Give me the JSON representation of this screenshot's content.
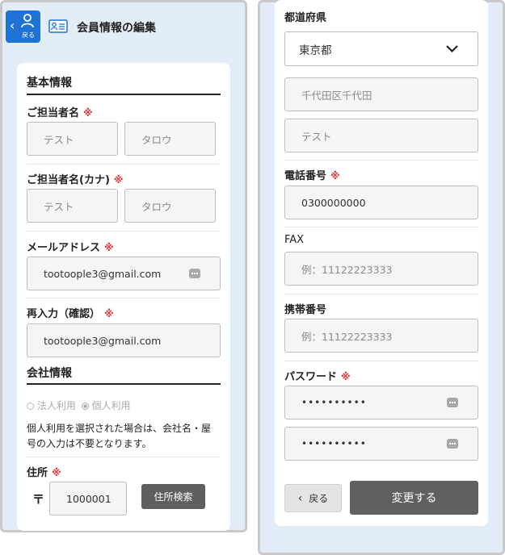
{
  "header": {
    "back_label": "戻る",
    "title": "会員情報の編集"
  },
  "basic": {
    "section_title": "基本情報",
    "contact_name_label": "ご担当者名",
    "contact_name_last": "テスト",
    "contact_name_first": "タロウ",
    "kana_label": "ご担当者名(カナ)",
    "kana_last": "テスト",
    "kana_first": "タロウ",
    "email_label": "メールアドレス",
    "email_value": "tootoople3@gmail.com",
    "email_confirm_label": "再入力（確認）",
    "email_confirm_value": "tootoople3@gmail.com",
    "required_mark": "※"
  },
  "company": {
    "section_title": "会社情報",
    "radio_corporate": "法人利用",
    "radio_personal": "個人利用",
    "selected": "個人利用",
    "note": [
      "個人利用を選択された場合は、会社名・屋",
      "号の入力は不要となります。"
    ]
  },
  "address": {
    "label": "住所",
    "postal_mark": "〒",
    "postal_code": "1000001",
    "search_button": "住所検索",
    "prefecture_label": "都道府県",
    "prefecture_value": "東京都",
    "address1_placeholder": "千代田区千代田",
    "address2_placeholder": "テスト"
  },
  "phone": {
    "label": "電話番号",
    "value": "0300000000"
  },
  "fax": {
    "label": "FAX",
    "placeholder": "例：11122223333"
  },
  "mobile": {
    "label": "携帯番号",
    "placeholder": "例：11122223333"
  },
  "password": {
    "label": "パスワード",
    "value": "••••••••••",
    "confirm_value": "••••••••••"
  },
  "footer": {
    "back_button": "戻る",
    "submit_button": "変更する"
  },
  "colors": {
    "header_blue": "#1f73d6",
    "required_red": "#e0363c",
    "submit_gray": "#606060",
    "search_gray": "#5f5f5f"
  }
}
